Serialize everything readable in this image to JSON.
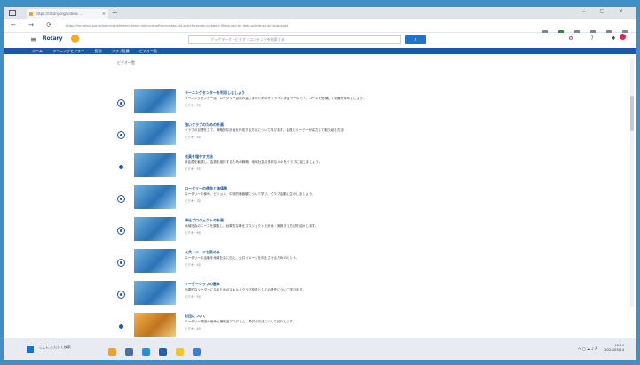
{
  "browser": {
    "tab_title": "https://rotary.org/videos ...",
    "tab_close": "×",
    "new_tab": "+",
    "url": "https://my.rotary.org/ja/learning-reference/learn-role/club-officers/video-list-search-results-category-filters-sort-by-date-published-all-languages",
    "nav": [
      "←",
      "→",
      "⟳"
    ],
    "window_controls": [
      "–",
      "▢",
      "×"
    ]
  },
  "site": {
    "logo": "Rotary",
    "search_placeholder": "ブックマーク・ビデオ・コンテンツを検索する",
    "search_button": "検索",
    "header_icons": [
      "⚙",
      "?",
      "♦"
    ]
  },
  "breadcrumb": [
    "ホーム",
    "ラーニングセンター",
    "役割",
    "クラブ役員",
    "ビデオ一覧"
  ],
  "page_subtitle": "ビデオ一覧",
  "items": [
    {
      "title": "ラーニングセンターを利用しましょう",
      "desc": "ラーニングセンターは、ロータリー会員の皆さまのためのオンライン学習ツールです。コースを受講して知識を深めましょう。",
      "meta": "ビデオ・3分",
      "thumb": "blue"
    },
    {
      "title": "強いクラブのための計画",
      "desc": "クラブの目標を立て、戦略的な計画を作成する方法について学びます。会員とリーダーが協力して取り組む方法。",
      "meta": "ビデオ・4分",
      "thumb": "blue"
    },
    {
      "title": "会員を増やす方法",
      "desc": "新会員を勧誘し、会員を維持するための戦略。地域社会の多様な人々をクラブに迎えましょう。",
      "meta": "ビデオ・5分",
      "thumb": "blue"
    },
    {
      "title": "ロータリーの使命と価値観",
      "desc": "ロータリーの使命、ビジョン、中核的価値観について学び、クラブ活動に生かしましょう。",
      "meta": "ビデオ・3分",
      "thumb": "blue"
    },
    {
      "title": "奉仕プロジェクトの計画",
      "desc": "地域社会のニーズを調査し、効果的な奉仕プロジェクトを計画・実施する方法を紹介します。",
      "meta": "ビデオ・6分",
      "thumb": "blue"
    },
    {
      "title": "公共イメージを高める",
      "desc": "ロータリーの活動を地域社会に伝え、公共イメージを向上させるためのヒント。",
      "meta": "ビデオ・4分",
      "thumb": "blue"
    },
    {
      "title": "リーダーシップの基本",
      "desc": "効果的なリーダーになるためのスキルとクラブ役員としての責任について学びます。",
      "meta": "ビデオ・5分",
      "thumb": "blue"
    },
    {
      "title": "財団について",
      "desc": "ロータリー財団の使命と補助金プログラム、寄付の方法について紹介します。",
      "meta": "ビデオ・4分",
      "thumb": "warm"
    }
  ],
  "taskbar": {
    "search_text": "ここに入力して検索",
    "tray_text": "へ ▢ ☁ ♪ A",
    "time": "16:24",
    "date": "2024/05/14"
  }
}
